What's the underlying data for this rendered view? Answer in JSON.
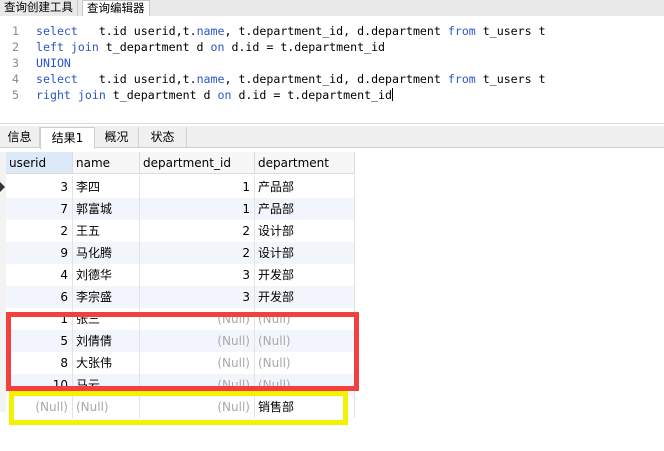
{
  "top_tabs": [
    "查询创建工具",
    "查询编辑器"
  ],
  "editor": {
    "lines": [
      {
        "n": "1",
        "parts": [
          [
            "kw",
            "select"
          ],
          [
            "t",
            "   t.id userid,t."
          ],
          [
            "kw",
            "name"
          ],
          [
            "t",
            ", t.department_id, d.department "
          ],
          [
            "kw",
            "from"
          ],
          [
            "t",
            " t_users t"
          ]
        ]
      },
      {
        "n": "2",
        "parts": [
          [
            "kw",
            "left join"
          ],
          [
            "t",
            " t_department d "
          ],
          [
            "kw",
            "on"
          ],
          [
            "t",
            " d.id = t.department_id"
          ]
        ]
      },
      {
        "n": "3",
        "parts": [
          [
            "kw",
            "UNION"
          ]
        ]
      },
      {
        "n": "4",
        "parts": [
          [
            "kw",
            "select"
          ],
          [
            "t",
            "   t.id userid,t."
          ],
          [
            "kw",
            "name"
          ],
          [
            "t",
            ", t.department_id, d.department "
          ],
          [
            "kw",
            "from"
          ],
          [
            "t",
            " t_users t"
          ]
        ]
      },
      {
        "n": "5",
        "parts": [
          [
            "kw",
            "right join"
          ],
          [
            "t",
            " t_department d "
          ],
          [
            "kw",
            "on"
          ],
          [
            "t",
            " d.id = t.department_id"
          ]
        ]
      }
    ]
  },
  "result_tabs": [
    "信息",
    "结果1",
    "概况",
    "状态"
  ],
  "grid": {
    "columns": [
      "userid",
      "name",
      "department_id",
      "department"
    ],
    "rows": [
      [
        "3",
        "李四",
        "1",
        "产品部"
      ],
      [
        "7",
        "郭富城",
        "1",
        "产品部"
      ],
      [
        "2",
        "王五",
        "2",
        "设计部"
      ],
      [
        "9",
        "马化腾",
        "2",
        "设计部"
      ],
      [
        "4",
        "刘德华",
        "3",
        "开发部"
      ],
      [
        "6",
        "李宗盛",
        "3",
        "开发部"
      ],
      [
        "1",
        "张三",
        "(Null)",
        "(Null)"
      ],
      [
        "5",
        "刘倩倩",
        "(Null)",
        "(Null)"
      ],
      [
        "8",
        "大张伟",
        "(Null)",
        "(Null)"
      ],
      [
        "10",
        "马云",
        "(Null)",
        "(Null)"
      ],
      [
        "(Null)",
        "(Null)",
        "(Null)",
        "销售部"
      ]
    ]
  },
  "colors": {
    "keyword": "#2c56c9",
    "highlight_red": "#f04040",
    "highlight_yellow": "#f5f200",
    "null_text": "#a8a8a8"
  }
}
